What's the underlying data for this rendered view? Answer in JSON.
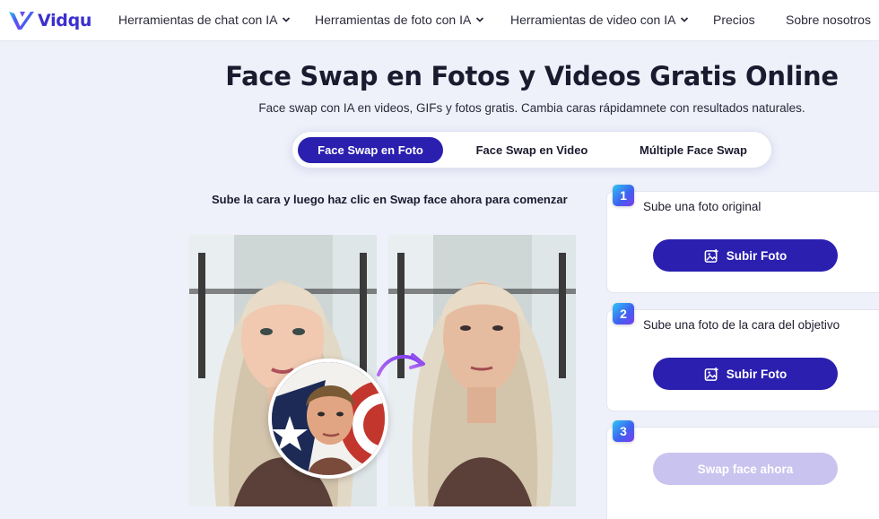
{
  "header": {
    "logo_text": "Vidqu",
    "nav": [
      {
        "label": "Herramientas de chat con IA",
        "has_dropdown": true
      },
      {
        "label": "Herramientas de foto con IA",
        "has_dropdown": true
      },
      {
        "label": "Herramientas de video con IA",
        "has_dropdown": true
      },
      {
        "label": "Precios",
        "has_dropdown": false
      },
      {
        "label": "Sobre nosotros",
        "has_dropdown": false
      }
    ]
  },
  "hero": {
    "title": "Face Swap en Fotos y Videos Gratis Online",
    "subtitle": "Face swap con IA en videos, GIFs y fotos gratis. Cambia caras rápidamnete con resultados naturales."
  },
  "tabs": [
    {
      "label": "Face Swap en Foto",
      "active": true
    },
    {
      "label": "Face Swap en Video",
      "active": false
    },
    {
      "label": "Múltiple Face Swap",
      "active": false
    }
  ],
  "instruction": "Sube la cara y luego haz clic en Swap face ahora para comenzar",
  "steps": [
    {
      "number": "1",
      "label": "Sube una foto original",
      "button": "Subir Foto",
      "button_icon": "image-add-icon"
    },
    {
      "number": "2",
      "label": "Sube una foto de la cara del objetivo",
      "button": "Subir Foto",
      "button_icon": "image-add-icon"
    },
    {
      "number": "3",
      "label": "",
      "button": "Swap face ahora"
    }
  ],
  "colors": {
    "brand": "#2b1fb0",
    "brand_disabled": "#c9c3ef",
    "page_bg": "#eef0fa"
  }
}
